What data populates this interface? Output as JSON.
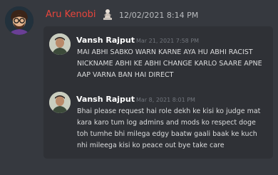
{
  "author": {
    "name": "Aru Kenobi",
    "timestamp": "12/02/2021 8:14 PM",
    "avatar_icon": "character-avatar",
    "role_icon": "figure-badge-icon",
    "name_color": "#e8453c"
  },
  "quoted_messages": [
    {
      "author": "Vansh Rajput",
      "timestamp": "Mar 21, 2021 7:58 PM",
      "text": "MAI ABHI SABKO WARN KARNE AYA HU ABHI RACIST NICKNAME ABHI KE ABHI CHANGE KARLO SAARE APNE AAP VARNA BAN HAI DIRECT"
    },
    {
      "author": "Vansh Rajput",
      "timestamp": "Mar 8, 2021 8:01 PM",
      "text": "Bhai please request hai role dekh ke kisi ko judge mat kara karo tum log admins and mods ko respect doge toh tumhe bhi milega edgy baatw gaali baak ke kuch nhi mileega kisi ko peace out bye take care"
    }
  ]
}
